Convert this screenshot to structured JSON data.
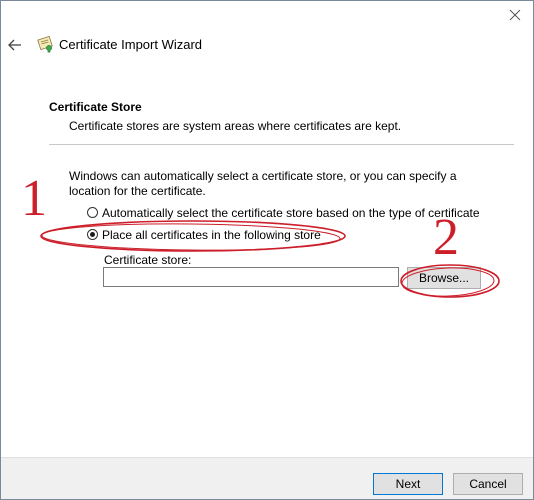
{
  "window": {
    "close_label": "×"
  },
  "header": {
    "title": "Certificate Import Wizard",
    "back_icon": "back-arrow-icon",
    "wizard_icon": "certificate-icon"
  },
  "section": {
    "title": "Certificate Store",
    "description": "Certificate stores are system areas where certificates are kept."
  },
  "body": {
    "intro": "Windows can automatically select a certificate store, or you can specify a location for the certificate.",
    "options": [
      {
        "label": "Automatically select the certificate store based on the type of certificate",
        "selected": false
      },
      {
        "label": "Place all certificates in the following store",
        "selected": true
      }
    ],
    "store_label": "Certificate store:",
    "store_value": "",
    "browse_label": "Browse..."
  },
  "footer": {
    "next_label": "Next",
    "cancel_label": "Cancel"
  },
  "annotations": {
    "marker_1": "1",
    "marker_2": "2",
    "color": "#cc1f2a"
  }
}
